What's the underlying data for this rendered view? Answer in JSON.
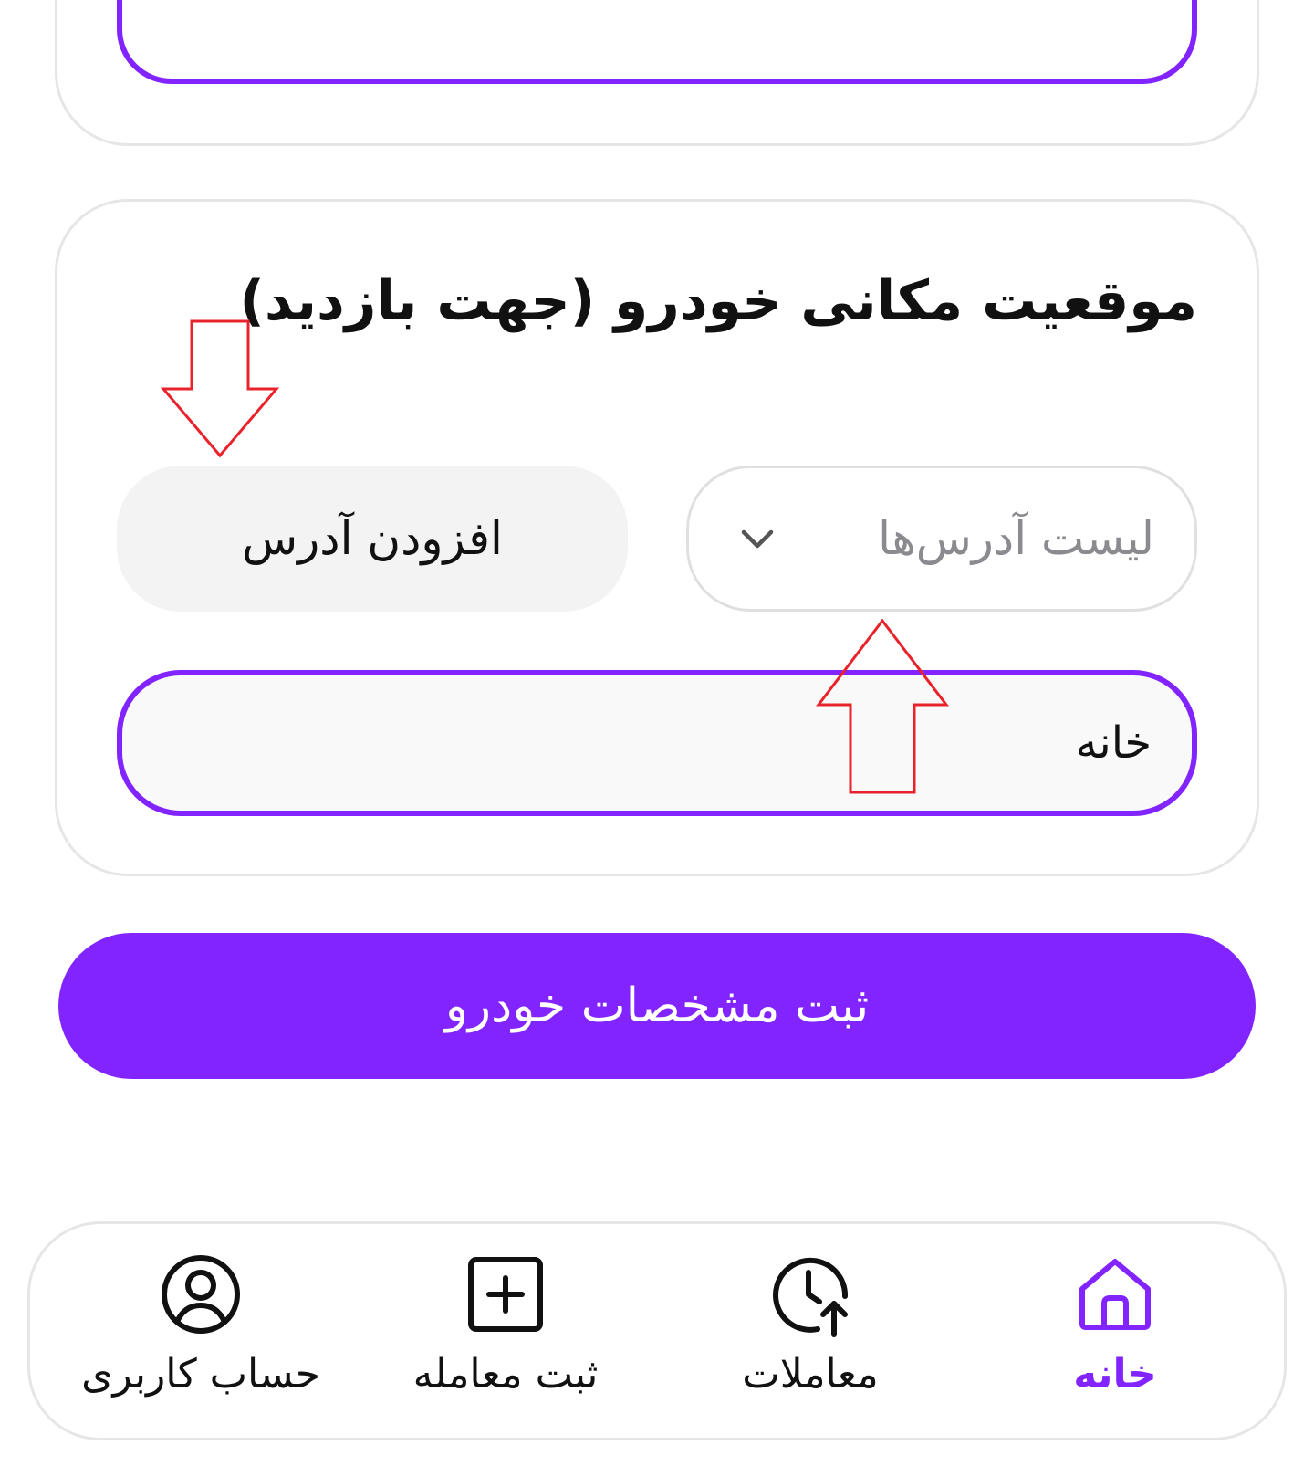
{
  "location_section": {
    "title": "موقعیت مکانی خودرو (جهت بازدید)",
    "add_address_label": "افزودن آدرس",
    "address_list_placeholder": "لیست آدرس‌ها",
    "selected_address": "خانه"
  },
  "submit": {
    "label": "ثبت مشخصات خودرو"
  },
  "bottom_nav": {
    "items": [
      {
        "label": "خانه",
        "icon": "home-icon"
      },
      {
        "label": "معاملات",
        "icon": "history-icon"
      },
      {
        "label": "ثبت معامله",
        "icon": "add-square-icon"
      },
      {
        "label": "حساب کاربری",
        "icon": "user-circle-icon"
      }
    ],
    "active_index": 0
  },
  "colors": {
    "accent": "#8224ff",
    "annotation": "#e8232b",
    "border": "#e6e6e6",
    "muted_text": "#8a8a8f",
    "button_bg": "#f3f3f3"
  }
}
